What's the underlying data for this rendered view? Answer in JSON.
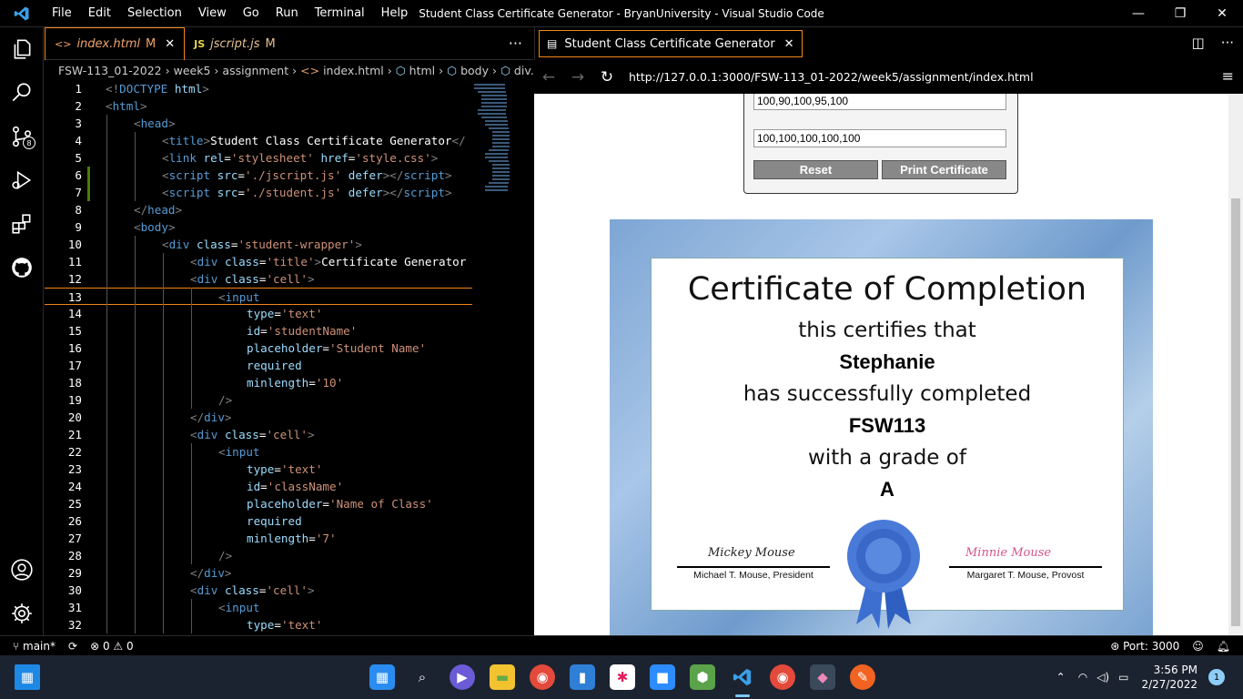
{
  "window": {
    "title": "Student Class Certificate Generator - BryanUniversity - Visual Studio Code",
    "menu": [
      "File",
      "Edit",
      "Selection",
      "View",
      "Go",
      "Run",
      "Terminal",
      "Help"
    ],
    "controls": {
      "minimize": "—",
      "restore": "❐",
      "close": "✕"
    }
  },
  "activity_bar": {
    "scm_badge": "8"
  },
  "editor": {
    "tabs": [
      {
        "icon": "<>",
        "label": "index.html",
        "modified": "M",
        "close": "✕"
      },
      {
        "icon": "JS",
        "label": "jscript.js",
        "modified": "M"
      }
    ],
    "more": "···",
    "breadcrumb": [
      "FSW-113_01-2022",
      "week5",
      "assignment",
      "index.html",
      "html",
      "body",
      "div.s"
    ],
    "lines": [
      {
        "n": "1",
        "indent": 0,
        "parts": [
          [
            "pu",
            "<!"
          ],
          [
            "tg",
            "DOCTYPE "
          ],
          [
            "at",
            "html"
          ],
          [
            "pu",
            ">"
          ]
        ]
      },
      {
        "n": "2",
        "indent": 0,
        "parts": [
          [
            "pu",
            "<"
          ],
          [
            "tg",
            "html"
          ],
          [
            "pu",
            ">"
          ]
        ]
      },
      {
        "n": "3",
        "indent": 1,
        "parts": [
          [
            "pu",
            "<"
          ],
          [
            "tg",
            "head"
          ],
          [
            "pu",
            ">"
          ]
        ]
      },
      {
        "n": "4",
        "indent": 2,
        "parts": [
          [
            "pu",
            "<"
          ],
          [
            "tg",
            "title"
          ],
          [
            "pu",
            ">"
          ],
          [
            "tx",
            "Student Class Certificate Generator"
          ],
          [
            "pu",
            "</"
          ]
        ]
      },
      {
        "n": "5",
        "indent": 2,
        "parts": [
          [
            "pu",
            "<"
          ],
          [
            "tg",
            "link "
          ],
          [
            "at",
            "rel"
          ],
          [
            "tx",
            "="
          ],
          [
            "st",
            "'stylesheet'"
          ],
          [
            "tx",
            " "
          ],
          [
            "at",
            "href"
          ],
          [
            "tx",
            "="
          ],
          [
            "st",
            "'style.css'"
          ],
          [
            "pu",
            ">"
          ]
        ]
      },
      {
        "n": "6",
        "indent": 2,
        "parts": [
          [
            "pu",
            "<"
          ],
          [
            "tg",
            "script "
          ],
          [
            "at",
            "src"
          ],
          [
            "tx",
            "="
          ],
          [
            "st",
            "'./jscript.js'"
          ],
          [
            "tx",
            " "
          ],
          [
            "at",
            "defer"
          ],
          [
            "pu",
            "></"
          ],
          [
            "tg",
            "script"
          ],
          [
            "pu",
            ">"
          ]
        ]
      },
      {
        "n": "7",
        "indent": 2,
        "parts": [
          [
            "pu",
            "<"
          ],
          [
            "tg",
            "script "
          ],
          [
            "at",
            "src"
          ],
          [
            "tx",
            "="
          ],
          [
            "st",
            "'./student.js'"
          ],
          [
            "tx",
            " "
          ],
          [
            "at",
            "defer"
          ],
          [
            "pu",
            "></"
          ],
          [
            "tg",
            "script"
          ],
          [
            "pu",
            ">"
          ]
        ]
      },
      {
        "n": "8",
        "indent": 1,
        "parts": [
          [
            "pu",
            "</"
          ],
          [
            "tg",
            "head"
          ],
          [
            "pu",
            ">"
          ]
        ]
      },
      {
        "n": "9",
        "indent": 1,
        "parts": [
          [
            "pu",
            "<"
          ],
          [
            "tg",
            "body"
          ],
          [
            "pu",
            ">"
          ]
        ]
      },
      {
        "n": "10",
        "indent": 2,
        "parts": [
          [
            "pu",
            "<"
          ],
          [
            "tg",
            "div "
          ],
          [
            "at",
            "class"
          ],
          [
            "tx",
            "="
          ],
          [
            "st",
            "'student-wrapper'"
          ],
          [
            "pu",
            ">"
          ]
        ]
      },
      {
        "n": "11",
        "indent": 3,
        "parts": [
          [
            "pu",
            "<"
          ],
          [
            "tg",
            "div "
          ],
          [
            "at",
            "class"
          ],
          [
            "tx",
            "="
          ],
          [
            "st",
            "'title'"
          ],
          [
            "pu",
            ">"
          ],
          [
            "tx",
            "Certificate Generator"
          ]
        ]
      },
      {
        "n": "12",
        "indent": 3,
        "parts": [
          [
            "pu",
            "<"
          ],
          [
            "tg",
            "div "
          ],
          [
            "at",
            "class"
          ],
          [
            "tx",
            "="
          ],
          [
            "st",
            "'cell'"
          ],
          [
            "pu",
            ">"
          ]
        ]
      },
      {
        "n": "13",
        "indent": 4,
        "parts": [
          [
            "pu",
            "<"
          ],
          [
            "tg",
            "input"
          ]
        ]
      },
      {
        "n": "14",
        "indent": 5,
        "parts": [
          [
            "at",
            "type"
          ],
          [
            "tx",
            "="
          ],
          [
            "st",
            "'text'"
          ]
        ]
      },
      {
        "n": "15",
        "indent": 5,
        "parts": [
          [
            "at",
            "id"
          ],
          [
            "tx",
            "="
          ],
          [
            "st",
            "'studentName'"
          ]
        ]
      },
      {
        "n": "16",
        "indent": 5,
        "parts": [
          [
            "at",
            "placeholder"
          ],
          [
            "tx",
            "="
          ],
          [
            "st",
            "'Student Name'"
          ]
        ]
      },
      {
        "n": "17",
        "indent": 5,
        "parts": [
          [
            "at",
            "required"
          ]
        ]
      },
      {
        "n": "18",
        "indent": 5,
        "parts": [
          [
            "at",
            "minlength"
          ],
          [
            "tx",
            "="
          ],
          [
            "st",
            "'10'"
          ]
        ]
      },
      {
        "n": "19",
        "indent": 4,
        "parts": [
          [
            "pu",
            "/>"
          ]
        ]
      },
      {
        "n": "20",
        "indent": 3,
        "parts": [
          [
            "pu",
            "</"
          ],
          [
            "tg",
            "div"
          ],
          [
            "pu",
            ">"
          ]
        ]
      },
      {
        "n": "21",
        "indent": 3,
        "parts": [
          [
            "pu",
            "<"
          ],
          [
            "tg",
            "div "
          ],
          [
            "at",
            "class"
          ],
          [
            "tx",
            "="
          ],
          [
            "st",
            "'cell'"
          ],
          [
            "pu",
            ">"
          ]
        ]
      },
      {
        "n": "22",
        "indent": 4,
        "parts": [
          [
            "pu",
            "<"
          ],
          [
            "tg",
            "input"
          ]
        ]
      },
      {
        "n": "23",
        "indent": 5,
        "parts": [
          [
            "at",
            "type"
          ],
          [
            "tx",
            "="
          ],
          [
            "st",
            "'text'"
          ]
        ]
      },
      {
        "n": "24",
        "indent": 5,
        "parts": [
          [
            "at",
            "id"
          ],
          [
            "tx",
            "="
          ],
          [
            "st",
            "'className'"
          ]
        ]
      },
      {
        "n": "25",
        "indent": 5,
        "parts": [
          [
            "at",
            "placeholder"
          ],
          [
            "tx",
            "="
          ],
          [
            "st",
            "'Name of Class'"
          ]
        ]
      },
      {
        "n": "26",
        "indent": 5,
        "parts": [
          [
            "at",
            "required"
          ]
        ]
      },
      {
        "n": "27",
        "indent": 5,
        "parts": [
          [
            "at",
            "minlength"
          ],
          [
            "tx",
            "="
          ],
          [
            "st",
            "'7'"
          ]
        ]
      },
      {
        "n": "28",
        "indent": 4,
        "parts": [
          [
            "pu",
            "/>"
          ]
        ]
      },
      {
        "n": "29",
        "indent": 3,
        "parts": [
          [
            "pu",
            "</"
          ],
          [
            "tg",
            "div"
          ],
          [
            "pu",
            ">"
          ]
        ]
      },
      {
        "n": "30",
        "indent": 3,
        "parts": [
          [
            "pu",
            "<"
          ],
          [
            "tg",
            "div "
          ],
          [
            "at",
            "class"
          ],
          [
            "tx",
            "="
          ],
          [
            "st",
            "'cell'"
          ],
          [
            "pu",
            ">"
          ]
        ]
      },
      {
        "n": "31",
        "indent": 4,
        "parts": [
          [
            "pu",
            "<"
          ],
          [
            "tg",
            "input"
          ]
        ]
      },
      {
        "n": "32",
        "indent": 5,
        "parts": [
          [
            "at",
            "type"
          ],
          [
            "tx",
            "="
          ],
          [
            "st",
            "'text'"
          ]
        ]
      }
    ],
    "current_line": "13",
    "modified_lines": [
      "6",
      "7"
    ]
  },
  "browser": {
    "tab_label": "Student Class Certificate Generator",
    "tab_close": "✕",
    "url": "http://127.0.0.1:3000/FSW-113_01-2022/week5/assignment/index.html",
    "form": {
      "input1_value": "100,90,100,95,100",
      "input2_value": "100,100,100,100,100",
      "reset_label": "Reset",
      "print_label": "Print Certificate"
    },
    "certificate": {
      "title": "Certificate of Completion",
      "line1": "this certifies that",
      "student": "Stephanie",
      "line2": "has successfully completed",
      "class_name": "FSW113",
      "line3": "with a grade of",
      "grade": "A",
      "sig_left_script": "Mickey Mouse",
      "sig_left_caption": "Michael T. Mouse, President",
      "sig_right_script": "Minnie Mouse",
      "sig_right_caption": "Margaret T. Mouse, Provost"
    }
  },
  "statusbar": {
    "branch": "main*",
    "errors": "0",
    "warnings": "0",
    "port": "Port: 3000"
  },
  "taskbar": {
    "time": "3:56 PM",
    "date": "2/27/2022",
    "notifications": "1"
  }
}
